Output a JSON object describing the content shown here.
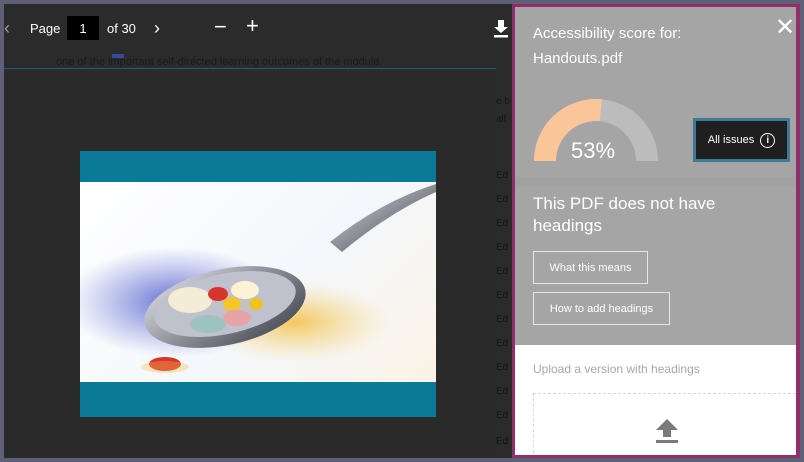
{
  "toolbar": {
    "page_label": "Page",
    "page_value": "1",
    "page_total": "of 30",
    "zoom_out": "−",
    "zoom_in": "+"
  },
  "document": {
    "top_line": "one of the important self-directed learning outcomes of the module.",
    "margin_letters": [
      "e b",
      "all",
      "Ed",
      "Ed",
      "Ed",
      "Ed",
      "Ed",
      "Ed",
      "Ed",
      "Ed",
      "Ed",
      "Ed",
      "Ed",
      "Ed"
    ]
  },
  "panel": {
    "title": "Accessibility score for:",
    "file_name": "Handouts.pdf",
    "score_text": "53%",
    "score_value": 53,
    "all_issues_label": "All issues",
    "close_label": "✕",
    "issue_heading": "This PDF does not have headings",
    "what_this_means": "What this means",
    "how_to_add": "How to add headings",
    "upload_label": "Upload a version with headings"
  },
  "colors": {
    "gauge_fill": "#fbc59a",
    "gauge_track": "#bcbcbc",
    "panel_border": "#8e2f6a",
    "slide_band": "#0b7a99"
  }
}
